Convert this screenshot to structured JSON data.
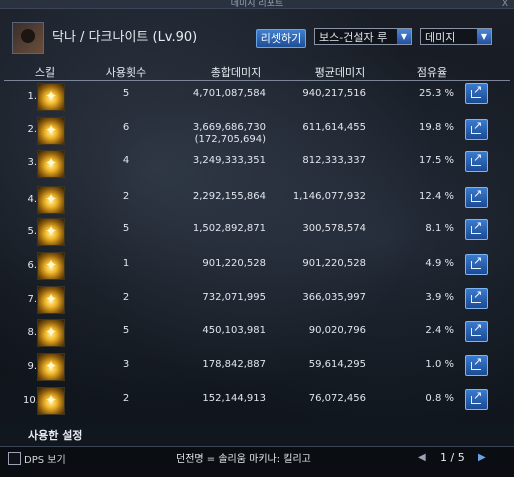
{
  "window": {
    "title": "데미지 리포트",
    "close_label": "X"
  },
  "header": {
    "player": "닥나 / 다크나이트 (Lv.90)",
    "reset_label": "리셋하기",
    "target_select": "보스-건설자 루",
    "metric_select": "데미지"
  },
  "columns": {
    "skill": "스킬",
    "count": "사용횟수",
    "total": "총합데미지",
    "avg": "평균데미지",
    "share": "점유율"
  },
  "rows": [
    {
      "rank": "1.",
      "count": "5",
      "total": "4,701,087,584",
      "avg": "940,217,516",
      "share": "25.3 %"
    },
    {
      "rank": "2.",
      "count": "6",
      "total": "3,669,686,730",
      "total_sub": "(172,705,694)",
      "avg": "611,614,455",
      "share": "19.8 %"
    },
    {
      "rank": "3.",
      "count": "4",
      "total": "3,249,333,351",
      "avg": "812,333,337",
      "share": "17.5 %"
    },
    {
      "rank": "4.",
      "count": "2",
      "total": "2,292,155,864",
      "avg": "1,146,077,932",
      "share": "12.4 %"
    },
    {
      "rank": "5.",
      "count": "5",
      "total": "1,502,892,871",
      "avg": "300,578,574",
      "share": "8.1 %"
    },
    {
      "rank": "6.",
      "count": "1",
      "total": "901,220,528",
      "avg": "901,220,528",
      "share": "4.9 %"
    },
    {
      "rank": "7.",
      "count": "2",
      "total": "732,071,995",
      "avg": "366,035,997",
      "share": "3.9 %"
    },
    {
      "rank": "8.",
      "count": "5",
      "total": "450,103,981",
      "avg": "90,020,796",
      "share": "2.4 %"
    },
    {
      "rank": "9.",
      "count": "3",
      "total": "178,842,887",
      "avg": "59,614,295",
      "share": "1.0 %"
    },
    {
      "rank": "10.",
      "count": "2",
      "total": "152,144,913",
      "avg": "76,072,456",
      "share": "0.8 %"
    }
  ],
  "footer": {
    "settings_label": "사용한 설정",
    "dps_label": "DPS 보기",
    "dungeon": "던전명 = 솔리움 마키나: 킬리고",
    "page": "1 / 5",
    "prev_icon": "◀",
    "next_icon": "▶"
  },
  "colors": {
    "accent": "#2f6cc4",
    "text": "#e2e6ee",
    "background": "#0c0f14"
  }
}
